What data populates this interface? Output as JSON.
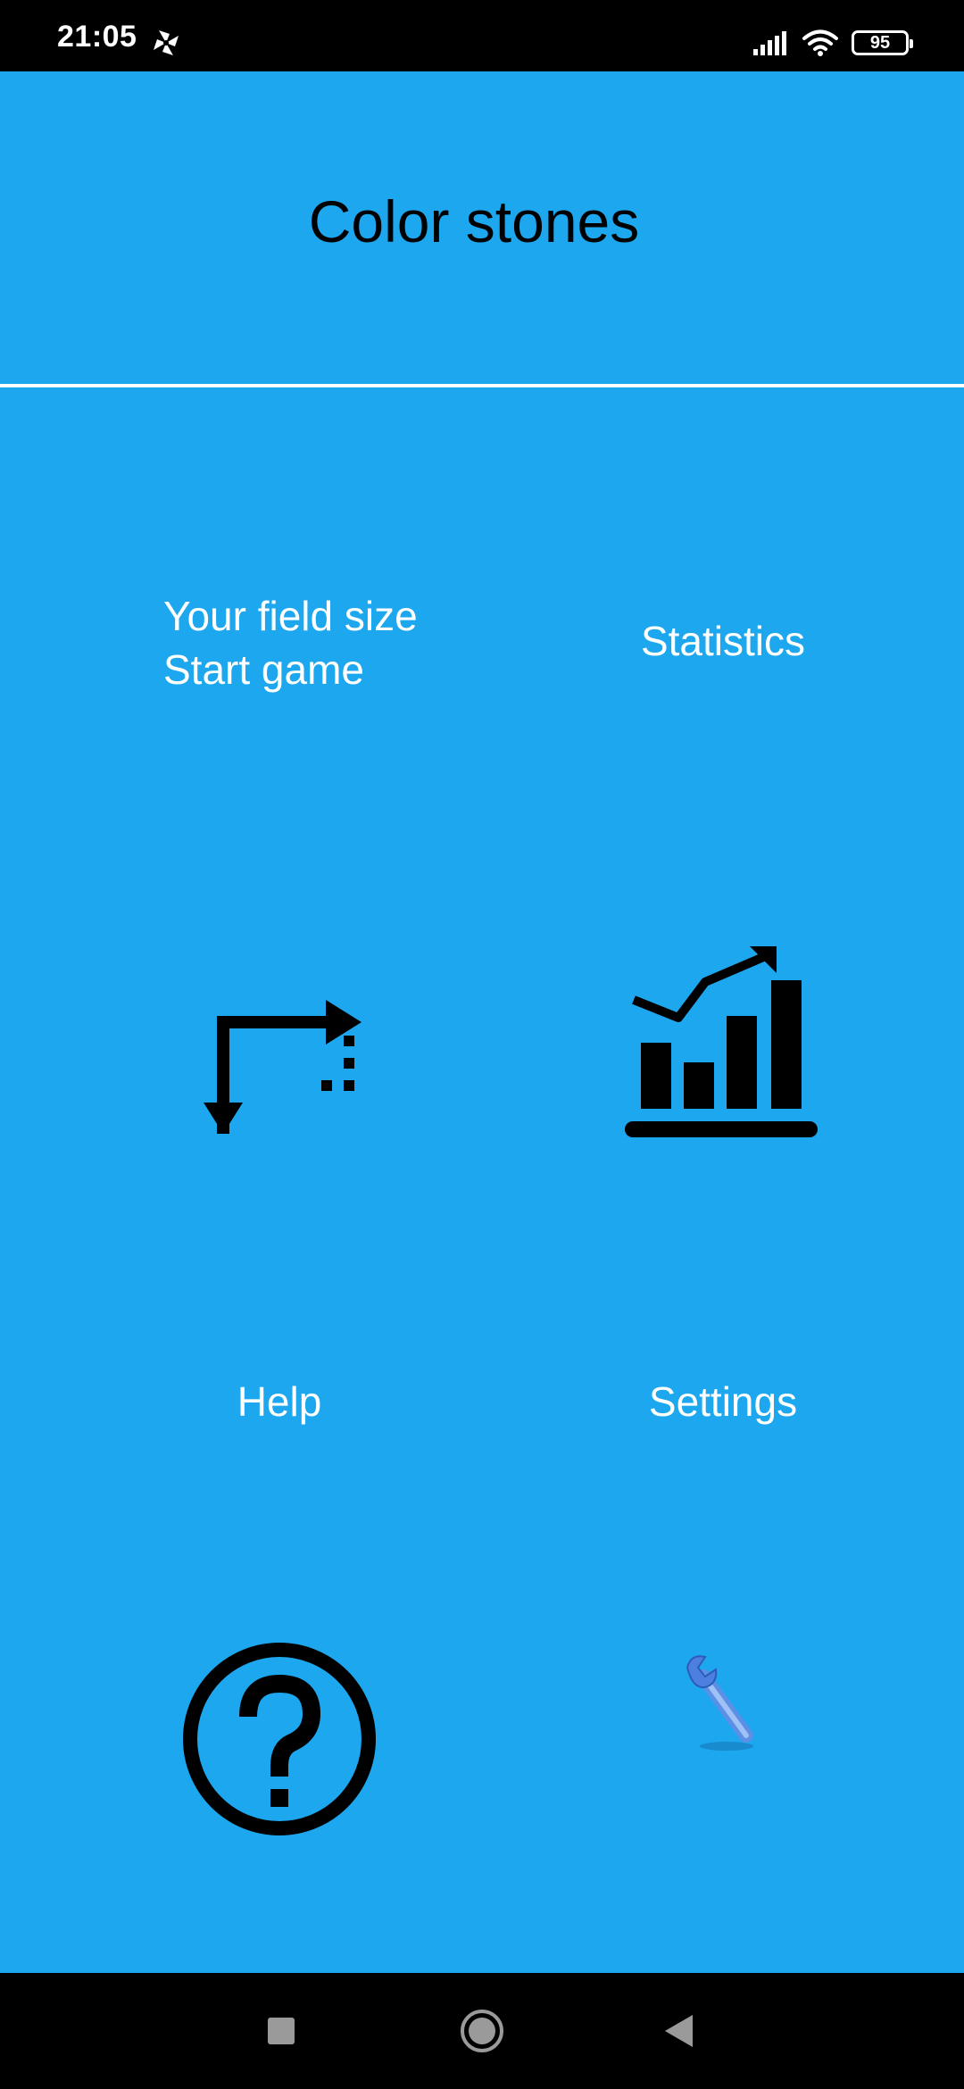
{
  "status_bar": {
    "time": "21:05",
    "app_icon": "pinwheel-icon",
    "signal_icon": "signal-icon",
    "wifi_icon": "wifi-icon",
    "battery_level": "95"
  },
  "app": {
    "title": "Color stones",
    "background_color": "#1da7ef",
    "divider_color": "#ffffff"
  },
  "menu": {
    "field_size": {
      "line1": "Your field size",
      "line2": "Start game",
      "icon": "resize-arrows-icon"
    },
    "statistics": {
      "label": "Statistics",
      "icon": "bar-chart-trend-icon"
    },
    "help": {
      "label": "Help",
      "icon": "question-circle-icon"
    },
    "settings": {
      "label": "Settings",
      "icon": "wrench-icon"
    }
  },
  "nav_bar": {
    "recent_icon": "square-icon",
    "home_icon": "circle-icon",
    "back_icon": "triangle-back-icon"
  }
}
